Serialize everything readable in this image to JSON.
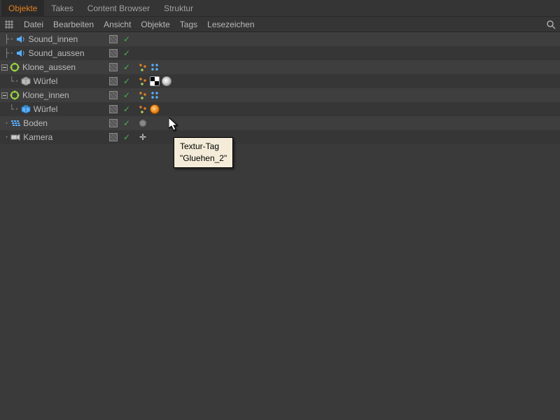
{
  "tabs": {
    "items": [
      "Objekte",
      "Takes",
      "Content Browser",
      "Struktur"
    ],
    "activeIndex": 0
  },
  "menubar": {
    "items": [
      "Datei",
      "Bearbeiten",
      "Ansicht",
      "Objekte",
      "Tags",
      "Lesezeichen"
    ]
  },
  "objects": [
    {
      "name": "Sound_innen",
      "depth": 1,
      "expander": "none",
      "icon": "sound",
      "tags": []
    },
    {
      "name": "Sound_aussen",
      "depth": 1,
      "expander": "none",
      "icon": "sound",
      "tags": []
    },
    {
      "name": "Klone_aussen",
      "depth": 0,
      "expander": "open",
      "icon": "cloner",
      "tags": [
        "dots",
        "blue-dots"
      ]
    },
    {
      "name": "Würfel",
      "depth": 1,
      "expander": "none-child",
      "icon": "cube",
      "tags": [
        "dots",
        "tex-checker",
        "tex-sphere"
      ]
    },
    {
      "name": "Klone_innen",
      "depth": 0,
      "expander": "open",
      "icon": "cloner",
      "tags": [
        "dots",
        "blue-dots"
      ]
    },
    {
      "name": "Würfel",
      "depth": 1,
      "expander": "none-child",
      "icon": "cube-b",
      "tags": [
        "dots",
        "tex-orange"
      ]
    },
    {
      "name": "Boden",
      "depth": 0,
      "expander": "leaf",
      "icon": "floor",
      "tags": [
        "gear"
      ]
    },
    {
      "name": "Kamera",
      "depth": 0,
      "expander": "leaf",
      "icon": "camera",
      "tags": [
        "crosshair"
      ]
    }
  ],
  "tooltip": {
    "line1": "Textur-Tag",
    "line2": "\"Gluehen_2\""
  },
  "colors": {
    "accent": "#e08020",
    "rowOdd": "#3e3e3e",
    "rowEven": "#363636",
    "check": "#4caf50"
  }
}
